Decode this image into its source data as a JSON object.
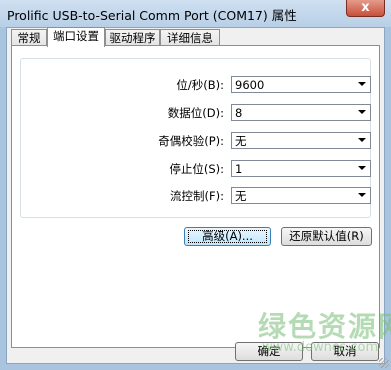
{
  "window": {
    "title": "Prolific USB-to-Serial Comm Port (COM17) 属性",
    "close_label": "x"
  },
  "tabs": [
    {
      "label": "常规"
    },
    {
      "label": "端口设置"
    },
    {
      "label": "驱动程序"
    },
    {
      "label": "详细信息"
    }
  ],
  "settings": [
    {
      "label": "位/秒(B):",
      "value": "9600"
    },
    {
      "label": "数据位(D):",
      "value": "8"
    },
    {
      "label": "奇偶校验(P):",
      "value": "无"
    },
    {
      "label": "停止位(S):",
      "value": "1"
    },
    {
      "label": "流控制(F):",
      "value": "无"
    }
  ],
  "buttons": {
    "advanced": "高级(A)...",
    "restore_defaults": "还原默认值(R)",
    "ok": "确定",
    "cancel": "取消"
  },
  "watermark": {
    "text": "绿色资源网",
    "sub": "www.downcc.com"
  }
}
